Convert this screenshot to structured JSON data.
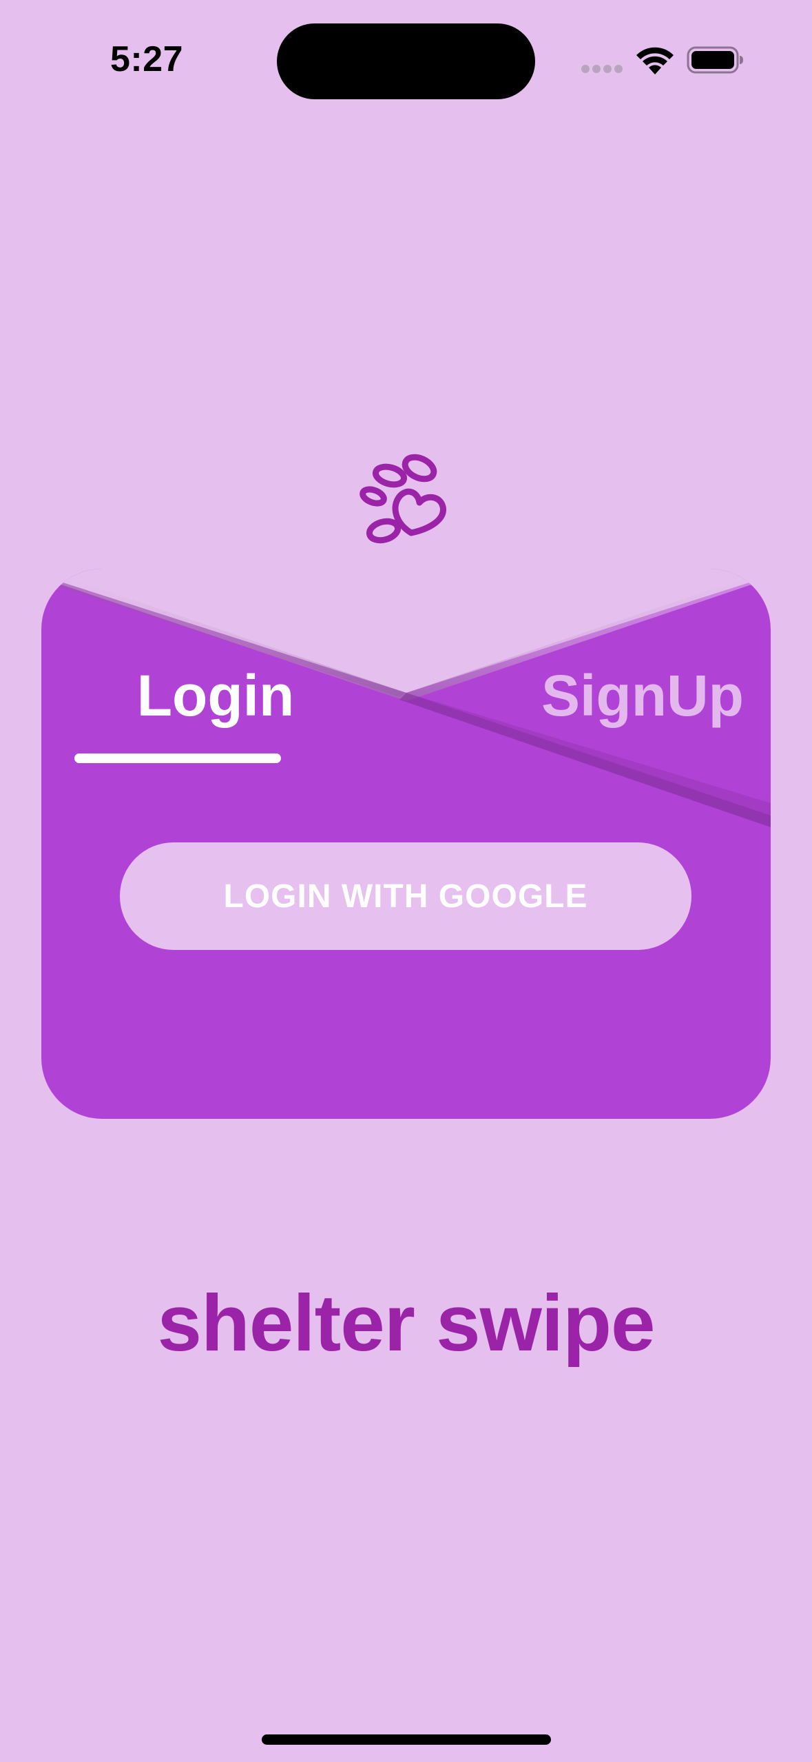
{
  "status_bar": {
    "time": "5:27"
  },
  "icons": {
    "logo": "paw-heart-icon",
    "wifi": "wifi-icon",
    "battery": "battery-icon"
  },
  "auth": {
    "tabs": [
      {
        "label": "Login",
        "active": true
      },
      {
        "label": "SignUp",
        "active": false
      }
    ],
    "google_button_label": "LOGIN WITH GOOGLE"
  },
  "brand": {
    "name": "shelter swipe"
  },
  "colors": {
    "background": "#e5bfee",
    "card": "#b142d6",
    "brand": "#9a23a8",
    "button": "#e6c0ef"
  }
}
